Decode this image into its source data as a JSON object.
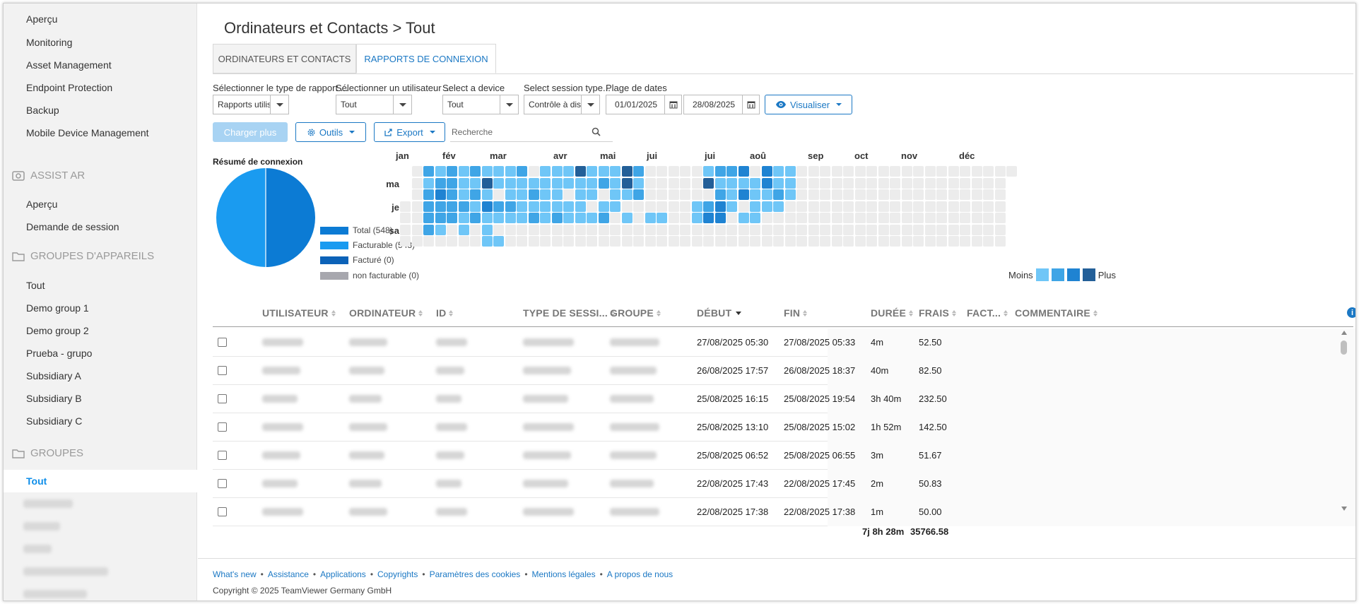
{
  "sidebar": {
    "top_items": [
      "Aperçu",
      "Monitoring",
      "Asset Management",
      "Endpoint Protection",
      "Backup",
      "Mobile Device Management"
    ],
    "assist_section": "ASSIST AR",
    "assist_items": [
      "Aperçu",
      "Demande de session"
    ],
    "device_groups_section": "GROUPES D'APPAREILS",
    "device_group_items": [
      "Tout",
      "Demo group 1",
      "Demo group 2",
      "Prueba - grupo",
      "Subsidiary A",
      "Subsidiary B",
      "Subsidiary C"
    ],
    "groups_section": "GROUPES",
    "groups_active": "Tout"
  },
  "header": {
    "title": "Ordinateurs et Contacts > Tout"
  },
  "tabs": [
    {
      "label": "ORDINATEURS ET CONTACTS",
      "active": false
    },
    {
      "label": "RAPPORTS DE CONNEXION",
      "active": true
    }
  ],
  "filters": {
    "report_type": {
      "label": "Sélectionner le type de rapport ...",
      "value": "Rapports utilisat"
    },
    "user": {
      "label": "Sélectionner un utilisateur ...",
      "value": "Tout"
    },
    "device": {
      "label": "Select a device",
      "value": "Tout"
    },
    "session_type": {
      "label": "Select session type...",
      "value": "Contrôle à distar"
    },
    "date_range": {
      "label": "Plage de dates",
      "from": "01/01/2025",
      "to": "28/08/2025"
    },
    "visualize_label": "Visualiser"
  },
  "toolbar": {
    "load_more": "Charger plus",
    "tools": "Outils",
    "export": "Export",
    "search_placeholder": "Recherche"
  },
  "summary": {
    "title": "Résumé de connexion",
    "legend": [
      {
        "label": "Total (548)",
        "color": "#0c7bd4"
      },
      {
        "label": "Facturable (548)",
        "color": "#1a9bf0"
      },
      {
        "label": "Facturé (0)",
        "color": "#0c62b8"
      },
      {
        "label": "non facturable (0)",
        "color": "#a7a7ae"
      }
    ]
  },
  "heatmap": {
    "months": [
      "jan",
      "fév",
      "mar",
      "avr",
      "mai",
      "jui",
      "jui",
      "aoû",
      "sep",
      "oct",
      "nov",
      "déc"
    ],
    "day_labels": [
      "ma",
      "je",
      "sa"
    ],
    "scale_less": "Moins",
    "scale_more": "Plus",
    "scale_colors": [
      "#6fc6f7",
      "#3fa5e6",
      "#1f83d2",
      "#235f98"
    ],
    "empty_color": "#ececec"
  },
  "table": {
    "columns": [
      "UTILISATEUR",
      "ORDINATEUR",
      "ID",
      "TYPE DE SESSI...",
      "GROUPE",
      "DÉBUT",
      "FIN",
      "DURÉE",
      "FRAIS",
      "FACT...",
      "COMMENTAIRE"
    ],
    "rows": [
      {
        "start": "27/08/2025 05:30",
        "end": "27/08/2025 05:33",
        "duration": "4m",
        "fee": "52.50"
      },
      {
        "start": "26/08/2025 17:57",
        "end": "26/08/2025 18:37",
        "duration": "40m",
        "fee": "82.50"
      },
      {
        "start": "25/08/2025 16:15",
        "end": "25/08/2025 19:54",
        "duration": "3h 40m",
        "fee": "232.50"
      },
      {
        "start": "25/08/2025 13:10",
        "end": "25/08/2025 15:02",
        "duration": "1h 52m",
        "fee": "142.50"
      },
      {
        "start": "25/08/2025 06:52",
        "end": "25/08/2025 06:55",
        "duration": "3m",
        "fee": "51.67"
      },
      {
        "start": "22/08/2025 17:43",
        "end": "22/08/2025 17:45",
        "duration": "2m",
        "fee": "50.83"
      },
      {
        "start": "22/08/2025 17:38",
        "end": "22/08/2025 17:38",
        "duration": "1m",
        "fee": "50.00"
      }
    ],
    "total_duration": "7j 8h 28m",
    "total_fee": "35766.58"
  },
  "footer": {
    "links": [
      "What's new",
      "Assistance",
      "Applications",
      "Copyrights",
      "Paramètres des cookies",
      "Mentions légales",
      "A propos de nous"
    ],
    "copyright": "Copyright © 2025 TeamViewer Germany GmbH"
  }
}
